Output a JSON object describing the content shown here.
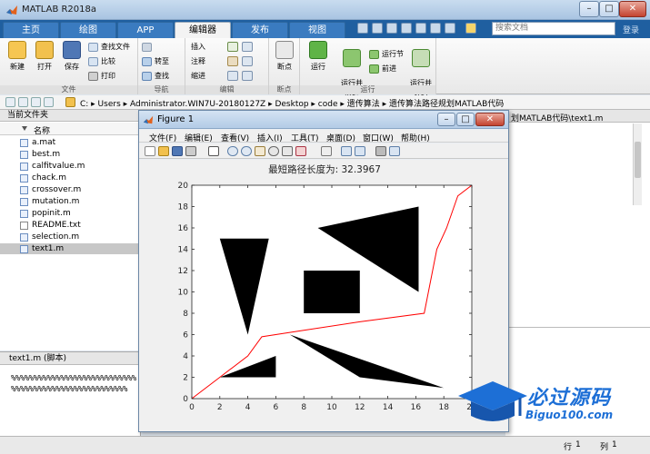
{
  "app": {
    "title": "MATLAB R2018a",
    "min": "–",
    "max": "□",
    "close": "✕"
  },
  "tabs": [
    {
      "label": "主页"
    },
    {
      "label": "绘图"
    },
    {
      "label": "APP"
    },
    {
      "label": "编辑器"
    },
    {
      "label": "发布"
    },
    {
      "label": "视图"
    }
  ],
  "search": {
    "placeholder": "搜索文档"
  },
  "collapse_label": "登录",
  "ribbon": {
    "file": {
      "label": "文件",
      "new": "新建",
      "open": "打开",
      "save": "保存",
      "find_files": "查找文件",
      "compare": "比较",
      "print": "打印"
    },
    "navigate": {
      "label": "导航",
      "goto": "转至",
      "find": "查找"
    },
    "edit": {
      "label": "编辑",
      "insert": "插入",
      "comment": "注释",
      "indent": "缩进"
    },
    "breakpoints": {
      "label": "断点",
      "breakpoints": "断点"
    },
    "run": {
      "label": "运行",
      "run": "运行",
      "run_advance": "运行并\n前进",
      "run_section": "运行节",
      "advance": "前进",
      "run_time": "运行并\n计时"
    }
  },
  "path": {
    "text": "C:  ▸  Users  ▸  Administrator.WIN7U-20180127Z  ▸  Desktop  ▸  code  ▸  遗传算法  ▸  遗传算法路径规划MATLAB代码"
  },
  "current_folder": {
    "title": "当前文件夹",
    "col_name": "名称",
    "files": [
      {
        "name": "a.mat"
      },
      {
        "name": "best.m"
      },
      {
        "name": "calfitvalue.m"
      },
      {
        "name": "chack.m"
      },
      {
        "name": "crossover.m"
      },
      {
        "name": "mutation.m"
      },
      {
        "name": "popinit.m"
      },
      {
        "name": "README.txt"
      },
      {
        "name": "selection.m"
      },
      {
        "name": "text1.m"
      }
    ]
  },
  "details": {
    "title": "text1.m  (脚本)",
    "lines": [
      "%%%%%%%%%%%%%%%%%%%%%%%%%%%%",
      "%%%%%%%%%%%%%%%%%%%%%%%%%%"
    ]
  },
  "editor_crumb": "划MATLAB代码\\text1.m",
  "status": {
    "row_label": "行",
    "row": "1",
    "col_label": "列",
    "col": "1"
  },
  "figure": {
    "title": "Figure 1",
    "menu": [
      "文件(F)",
      "编辑(E)",
      "查看(V)",
      "插入(I)",
      "工具(T)",
      "桌面(D)",
      "窗口(W)",
      "帮助(H)"
    ]
  },
  "chart_data": {
    "type": "line",
    "title": "最短路径长度为: 32.3967",
    "xlabel": "",
    "ylabel": "",
    "xlim": [
      0,
      20
    ],
    "ylim": [
      0,
      20
    ],
    "xticks": [
      0,
      2,
      4,
      6,
      8,
      10,
      12,
      14,
      16,
      18,
      20
    ],
    "yticks": [
      0,
      2,
      4,
      6,
      8,
      10,
      12,
      14,
      16,
      18,
      20
    ],
    "series": [
      {
        "name": "",
        "color": "#ff0000",
        "x": [
          0,
          2,
          4,
          5,
          8,
          12,
          16.6,
          16.9,
          17.5,
          18.2,
          19.0,
          20
        ],
        "y": [
          0,
          2,
          4,
          5.8,
          6.4,
          7.2,
          8.0,
          10.0,
          14.0,
          16.0,
          19.0,
          20
        ]
      }
    ],
    "obstacles": [
      {
        "color": "#000000",
        "points": [
          [
            2,
            15
          ],
          [
            5.5,
            15
          ],
          [
            4,
            6
          ]
        ]
      },
      {
        "color": "#000000",
        "points": [
          [
            9,
            16
          ],
          [
            16.2,
            18
          ],
          [
            16.2,
            10
          ]
        ]
      },
      {
        "color": "#000000",
        "points": [
          [
            8,
            12
          ],
          [
            12,
            12
          ],
          [
            12,
            8
          ],
          [
            8,
            8
          ]
        ]
      },
      {
        "color": "#000000",
        "points": [
          [
            2,
            2
          ],
          [
            6,
            4
          ],
          [
            6,
            2
          ]
        ]
      },
      {
        "color": "#000000",
        "points": [
          [
            7,
            6
          ],
          [
            12,
            2
          ],
          [
            18,
            1
          ]
        ]
      }
    ]
  },
  "watermark": {
    "line1": "必过源码",
    "line2": "Biguo100.com"
  }
}
